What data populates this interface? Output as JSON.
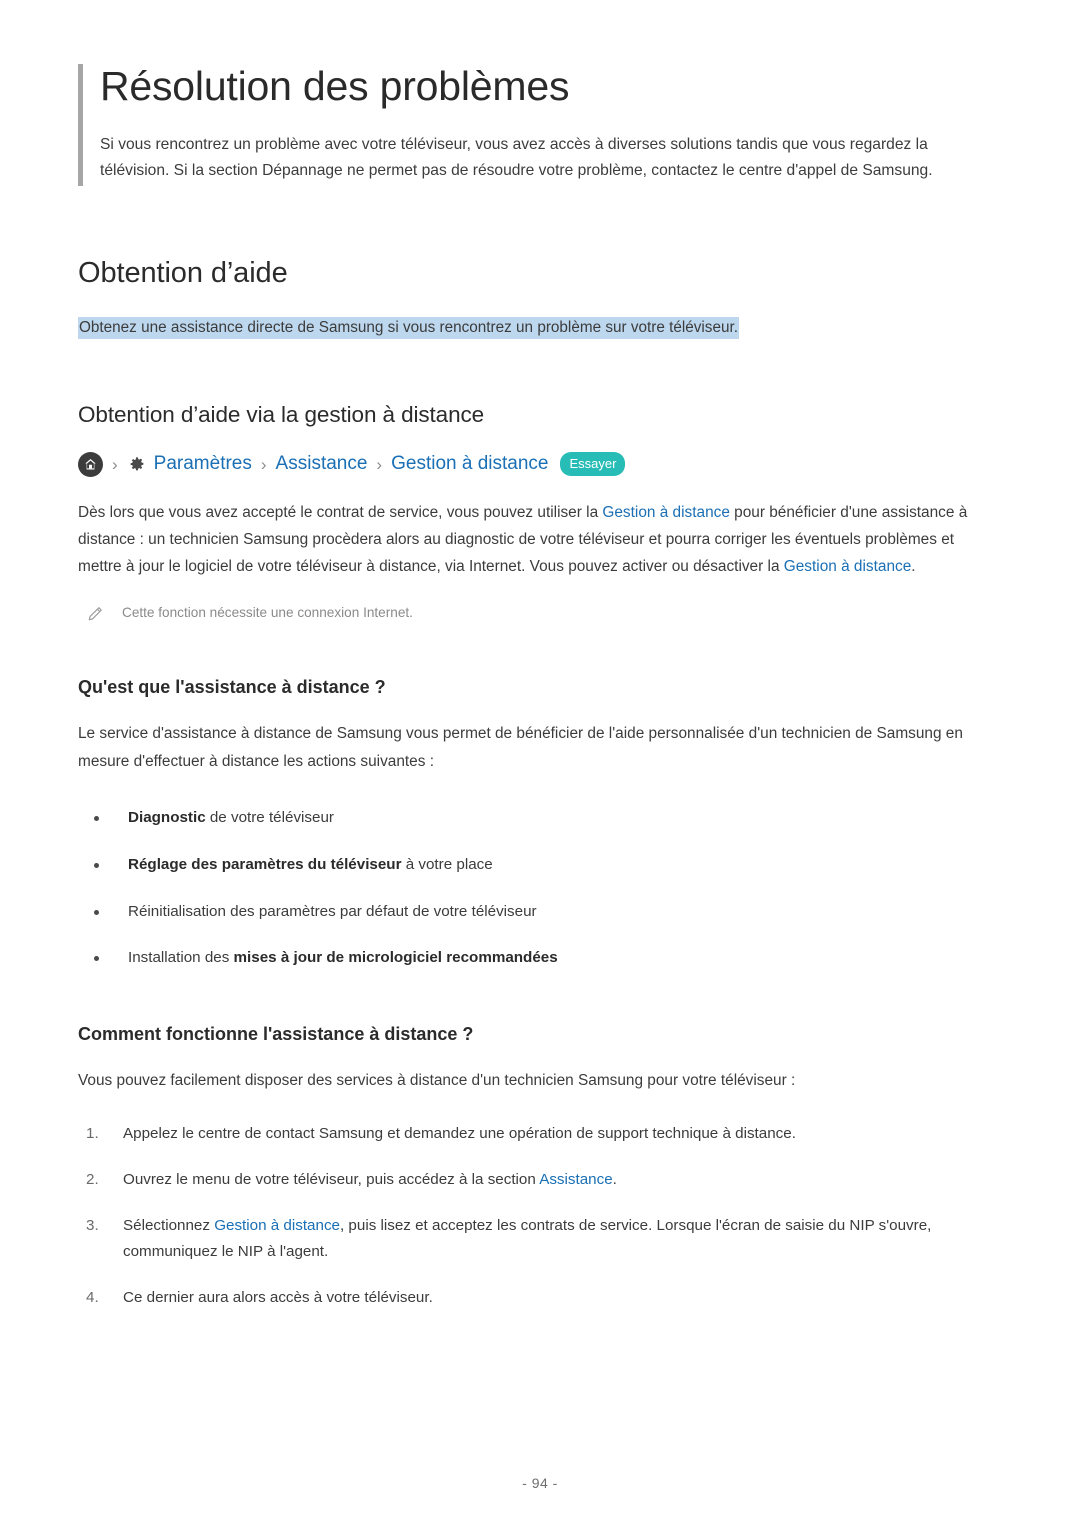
{
  "document": {
    "title": "Résolution des problèmes",
    "intro": "Si vous rencontrez un problème avec votre téléviseur, vous avez accès à diverses solutions tandis que vous regardez la télévision. Si la section Dépannage ne permet pas de résoudre votre problème, contactez le centre d'appel de Samsung.",
    "page_number": "- 94 -"
  },
  "section_help": {
    "heading": "Obtention d’aide",
    "highlighted_lead": "Obtenez une assistance directe de Samsung si vous rencontrez un problème sur votre téléviseur.",
    "highlight_color": "#bdd7ee"
  },
  "section_remote": {
    "heading": "Obtention d’aide via la gestion à distance",
    "breadcrumb": {
      "home_icon": "home-icon",
      "gear_icon": "gear-icon",
      "separator": "›",
      "items": [
        {
          "label": "Paramètres"
        },
        {
          "label": "Assistance"
        },
        {
          "label": "Gestion à distance"
        }
      ],
      "badge": "Essayer",
      "badge_color": "#27bcb6",
      "link_color": "#1a6fb5"
    },
    "paragraph": {
      "part1": "Dès lors que vous avez accepté le contrat de service, vous pouvez utiliser la ",
      "link1": "Gestion à distance",
      "part2": " pour bénéficier d'une assistance à distance : un technicien Samsung procèdera alors au diagnostic de votre téléviseur et pourra corriger les éventuels problèmes et mettre à jour le logiciel de votre téléviseur à distance, via Internet. Vous pouvez activer ou désactiver la ",
      "link2": "Gestion à distance",
      "part3": "."
    },
    "note": {
      "icon": "pencil-icon",
      "text": "Cette fonction nécessite une connexion Internet."
    }
  },
  "subsection_what": {
    "heading": "Qu'est que l'assistance à distance ?",
    "paragraph": "Le service d'assistance à distance de Samsung vous permet de bénéficier de l'aide personnalisée d'un technicien de Samsung en mesure d'effectuer à distance les actions suivantes :",
    "bullets": [
      {
        "bold": "Diagnostic",
        "rest": " de votre téléviseur",
        "bold_first": true
      },
      {
        "bold": "Réglage des paramètres du téléviseur",
        "rest": " à votre place",
        "bold_first": true
      },
      {
        "bold": "",
        "rest": "Réinitialisation des paramètres par défaut de votre téléviseur",
        "bold_first": true
      },
      {
        "lead": "Installation des ",
        "bold": "mises à jour de micrologiciel recommandées",
        "rest": "",
        "bold_first": false
      }
    ]
  },
  "subsection_how": {
    "heading": "Comment fonctionne l'assistance à distance ?",
    "paragraph": "Vous pouvez facilement disposer des services à distance d'un technicien Samsung pour votre téléviseur :",
    "steps": [
      {
        "text": "Appelez le centre de contact Samsung et demandez une opération de support technique à distance."
      },
      {
        "pre": "Ouvrez le menu de votre téléviseur, puis accédez à la section ",
        "link": "Assistance",
        "post": "."
      },
      {
        "pre": "Sélectionnez ",
        "link": "Gestion à distance",
        "post": ", puis lisez et acceptez les contrats de service. Lorsque l'écran de saisie du NIP s'ouvre, communiquez le NIP à l'agent."
      },
      {
        "text": "Ce dernier aura alors accès à votre téléviseur."
      }
    ]
  }
}
